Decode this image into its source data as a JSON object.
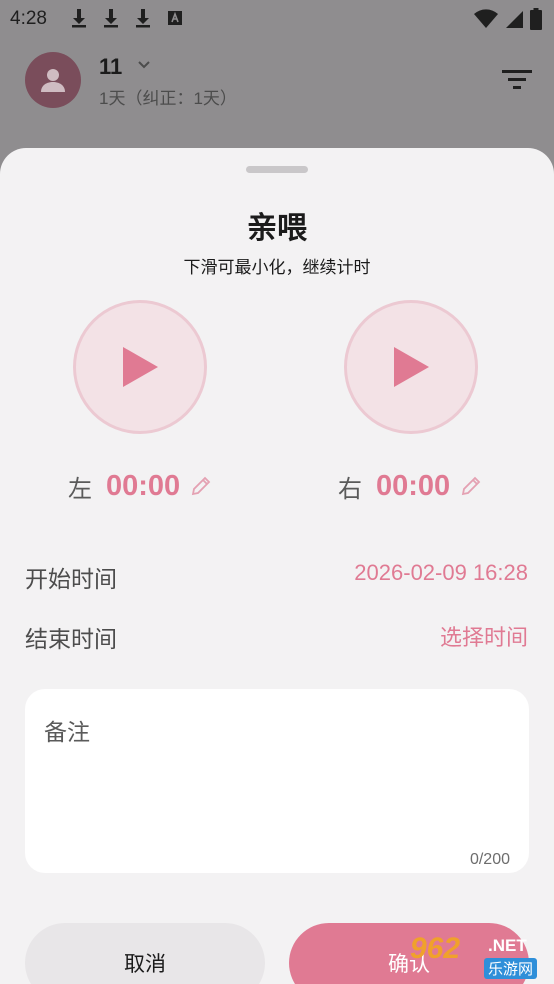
{
  "status_bar": {
    "time": "4:28"
  },
  "header": {
    "baby_name": "11",
    "baby_age": "1天（纠正：1天）"
  },
  "sheet": {
    "title": "亲喂",
    "subtitle": "下滑可最小化，继续计时",
    "left": {
      "label": "左",
      "timer": "00:00"
    },
    "right": {
      "label": "右",
      "timer": "00:00"
    },
    "start_time": {
      "label": "开始时间",
      "value": "2026-02-09 16:28"
    },
    "end_time": {
      "label": "结束时间",
      "value": "选择时间"
    },
    "note": {
      "placeholder": "备注",
      "counter": "0/200"
    },
    "cancel_label": "取消",
    "confirm_label": "确认"
  },
  "watermark": {
    "number": "962",
    "net": ".NET",
    "text": "乐游网"
  },
  "colors": {
    "accent": "#e07a93",
    "sheet_bg": "#f3f2f3",
    "scrim": "#8f8d8f"
  },
  "icons": [
    "download-icon",
    "a-icon",
    "wifi-icon",
    "signal-icon",
    "battery-icon",
    "person-icon",
    "chevron-down-icon",
    "filter-icon",
    "play-icon",
    "edit-icon"
  ]
}
